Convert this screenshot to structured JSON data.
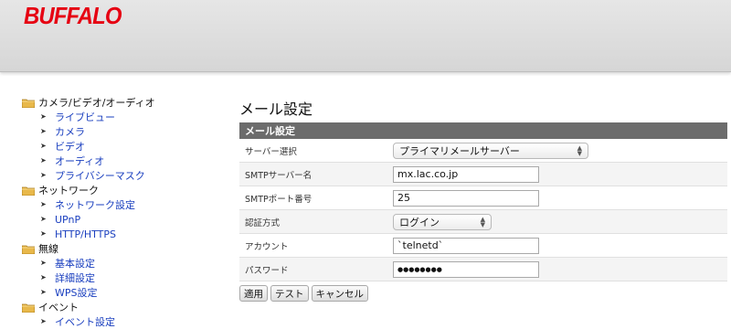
{
  "brand": {
    "logo_text": "BUFFALO",
    "logo_color": "#e60012"
  },
  "sidebar": {
    "groups": [
      {
        "title": "カメラ/ビデオ/オーディオ",
        "items": [
          "ライブビュー",
          "カメラ",
          "ビデオ",
          "オーディオ",
          "プライバシーマスク"
        ]
      },
      {
        "title": "ネットワーク",
        "items": [
          "ネットワーク設定",
          "UPnP",
          "HTTP/HTTPS"
        ]
      },
      {
        "title": "無線",
        "items": [
          "基本設定",
          "詳細設定",
          "WPS設定"
        ]
      },
      {
        "title": "イベント",
        "items": [
          "イベント設定"
        ]
      }
    ]
  },
  "main": {
    "title": "メール設定",
    "section_header": "メール設定",
    "fields": {
      "server_select": {
        "label": "サーバー選択",
        "value": "プライマリメールサーバー"
      },
      "smtp_server": {
        "label": "SMTPサーバー名",
        "value": "mx.lac.co.jp"
      },
      "smtp_port": {
        "label": "SMTPポート番号",
        "value": "25"
      },
      "auth_method": {
        "label": "認証方式",
        "value": "ログイン"
      },
      "account": {
        "label": "アカウント",
        "value": "`telnetd`"
      },
      "password": {
        "label": "パスワード",
        "value": "●●●●●●●●"
      }
    },
    "buttons": {
      "apply": "適用",
      "test": "テスト",
      "cancel": "キャンセル"
    }
  }
}
